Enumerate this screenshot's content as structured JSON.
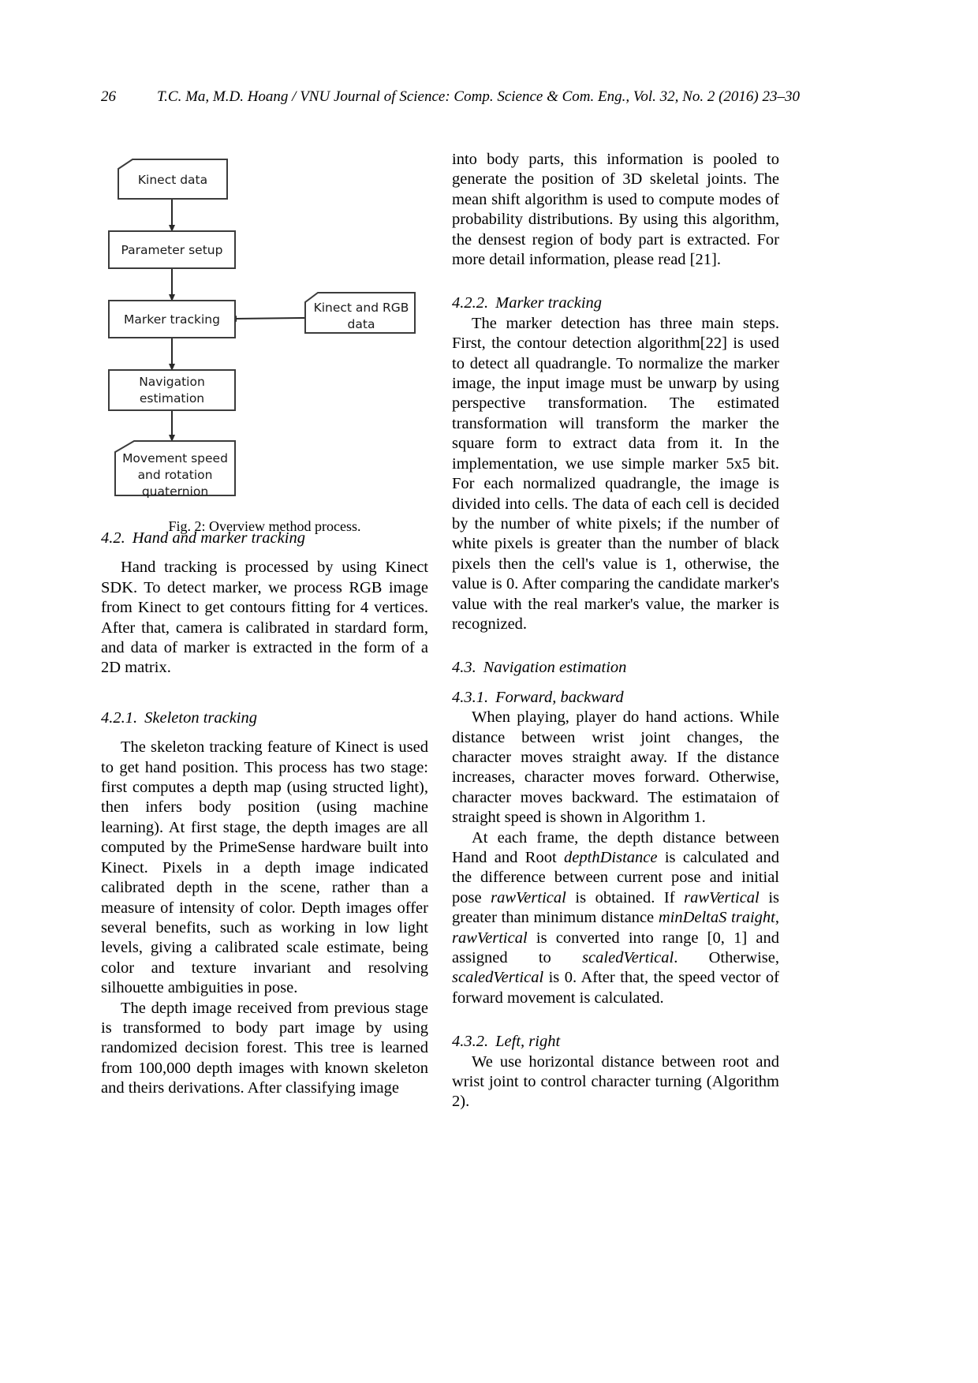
{
  "running_head": {
    "folio": "26",
    "text": "T.C. Ma, M.D. Hoang / VNU Journal of Science: Comp. Science & Com. Eng., Vol. 32, No. 2 (2016) 23–30"
  },
  "figure": {
    "caption": "Fig. 2: Overview method process.",
    "nodes": [
      {
        "id": "kinect-data",
        "label": "Kinect data",
        "shape": "data"
      },
      {
        "id": "parameter-setup",
        "label": "Parameter setup",
        "shape": "process"
      },
      {
        "id": "marker-tracking",
        "label": "Marker tracking",
        "shape": "process"
      },
      {
        "id": "kinect-rgb-data",
        "label_line1": "Kinect and RGB",
        "label_line2": "data",
        "shape": "data"
      },
      {
        "id": "navigation-estimation",
        "label_line1": "Navigation",
        "label_line2": "estimation",
        "shape": "process"
      },
      {
        "id": "movement-output",
        "label_line1": "Movement speed",
        "label_line2": "and rotation",
        "label_line3": "quaternion",
        "shape": "data"
      }
    ]
  },
  "left_column": {
    "sec_4_2": {
      "num": "4.2.",
      "title": "Hand and marker tracking",
      "para": "Hand tracking is processed by using Kinect SDK. To detect marker, we process RGB image from Kinect to get contours fitting for 4 vertices. After that, camera is calibrated in stardard form, and data of marker is extracted in the form of a 2D matrix."
    },
    "sec_4_2_1": {
      "num": "4.2.1.",
      "title": "Skeleton tracking",
      "para1": "The skeleton tracking feature of Kinect is used to get hand position.  This process has two stage: first computes a depth map (using structed light), then infers body position (using machine learning).  At first stage, the depth images are all computed by the PrimeSense hardware built into Kinect.  Pixels in a depth image indicated calibrated depth in the scene, rather than a measure of intensity of color.  Depth images offer several benefits, such as working in low light levels, giving a calibrated scale estimate, being color and texture invariant and resolving silhouette ambiguities in pose.",
      "para2": "The depth image received from previous stage is transformed to body part image by using randomized decision forest. This tree is learned from 100,000 depth images with known skeleton and theirs derivations.  After classifying image"
    }
  },
  "right_column": {
    "cont_para": "into body parts, this information is pooled to generate the position of 3D skeletal joints.  The mean shift algorithm is used to compute modes of probability distributions. By using this algorithm, the densest region of body part is extracted.  For more detail information, please read [21].",
    "sec_4_2_2": {
      "num": "4.2.2.",
      "title": "Marker tracking",
      "para": "The marker detection has three main steps. First, the contour detection algorithm[22] is used to detect all quadrangle. To normalize the marker image,  the input image must be unwarp by using perspective transformation.  The estimated transformation will transform the marker the square form to extract data from it.   In the implementation, we use simple marker 5x5 bit. For each normalized quadrangle, the image is divided into cells. The data of each cell is decided by the number of white pixels; if the number of white pixels is greater than the number of black pixels then the cell's value is 1, otherwise, the value is 0.  After comparing the candidate marker's value with the real marker's value, the marker is recognized."
    },
    "sec_4_3": {
      "num": "4.3.",
      "title": "Navigation estimation"
    },
    "sec_4_3_1": {
      "num": "4.3.1.",
      "title": "Forward, backward",
      "para1": "When  playing,  player  do  hand  actions. While distance between wrist joint changes, the character moves straight away.  If the distance increases, character moves forward.  Otherwise, character moves backward.  The estimataion of straight speed is shown in Algorithm 1.",
      "para2_parts": [
        {
          "type": "text",
          "value": "At each frame, the depth distance between Hand and Root "
        },
        {
          "type": "italic",
          "value": "depthDistance"
        },
        {
          "type": "text",
          "value": " is calculated and the difference between current pose and initial pose "
        },
        {
          "type": "italic",
          "value": "rawVertical"
        },
        {
          "type": "text",
          "value": " is obtained.    If "
        },
        {
          "type": "italic",
          "value": "rawVertical"
        },
        {
          "type": "text",
          "value": " is greater than minimum distance "
        },
        {
          "type": "italic",
          "value": "minDeltaS traight"
        },
        {
          "type": "text",
          "value": ", "
        },
        {
          "type": "italic",
          "value": "rawVertical"
        },
        {
          "type": "text",
          "value": " is converted into range [0, 1] and assigned to "
        },
        {
          "type": "italic",
          "value": "scaledVertical"
        },
        {
          "type": "text",
          "value": ". Otherwise, "
        },
        {
          "type": "italic",
          "value": "scaledVertical"
        },
        {
          "type": "text",
          "value": " is 0.  After that, the speed vector of forward movement is calculated."
        }
      ]
    },
    "sec_4_3_2": {
      "num": "4.3.2.",
      "title": "Left, right",
      "para": "We use horizontal distance between root and wrist joint to control character turning (Algorithm 2)."
    }
  }
}
